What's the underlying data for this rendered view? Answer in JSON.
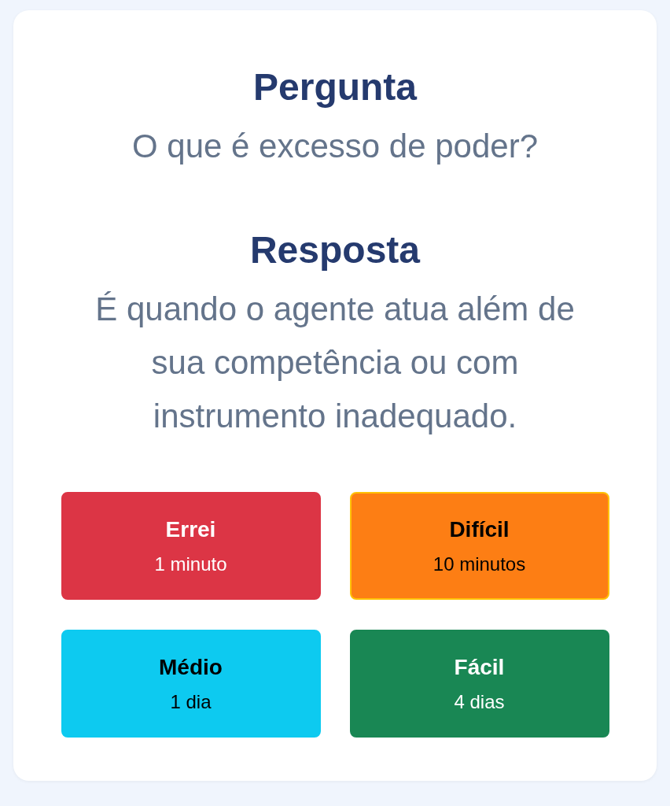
{
  "sections": [
    {
      "heading": "Pergunta",
      "text": "O que é excesso de poder?"
    },
    {
      "heading": "Resposta",
      "text": "É quando o agente atua além de sua competência ou com instrumento inadequado."
    }
  ],
  "buttons": [
    {
      "label": "Errei",
      "interval": "1 minuto",
      "color": "#dc3545",
      "selected": false
    },
    {
      "label": "Difícil",
      "interval": "10 minutos",
      "color": "#fd7e14",
      "selected": true
    },
    {
      "label": "Médio",
      "interval": "1 dia",
      "color": "#0dcaf0",
      "selected": false
    },
    {
      "label": "Fácil",
      "interval": "4 dias",
      "color": "#198754",
      "selected": false
    }
  ]
}
